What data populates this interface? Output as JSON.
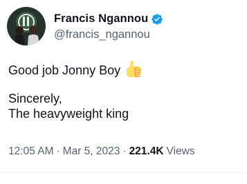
{
  "author": {
    "display_name": "Francis Ngannou",
    "handle": "@francis_ngannou",
    "verified": true,
    "avatar_icon": "profile-photo",
    "badge_icon": "verified-badge-icon",
    "badge_color": "#1d9bf0"
  },
  "tweet": {
    "line1": "Good job Jonny Boy",
    "line1_emoji": "thumbs-up-icon",
    "line2": "Sincerely,",
    "line3": "The heavyweight king"
  },
  "meta": {
    "time": "12:05 AM",
    "separator": "·",
    "date": "Mar 5, 2023",
    "views_count": "221.4K",
    "views_label": "Views"
  },
  "colors": {
    "text_primary": "#0f1419",
    "text_secondary": "#536471",
    "divider": "#eff3f4"
  }
}
